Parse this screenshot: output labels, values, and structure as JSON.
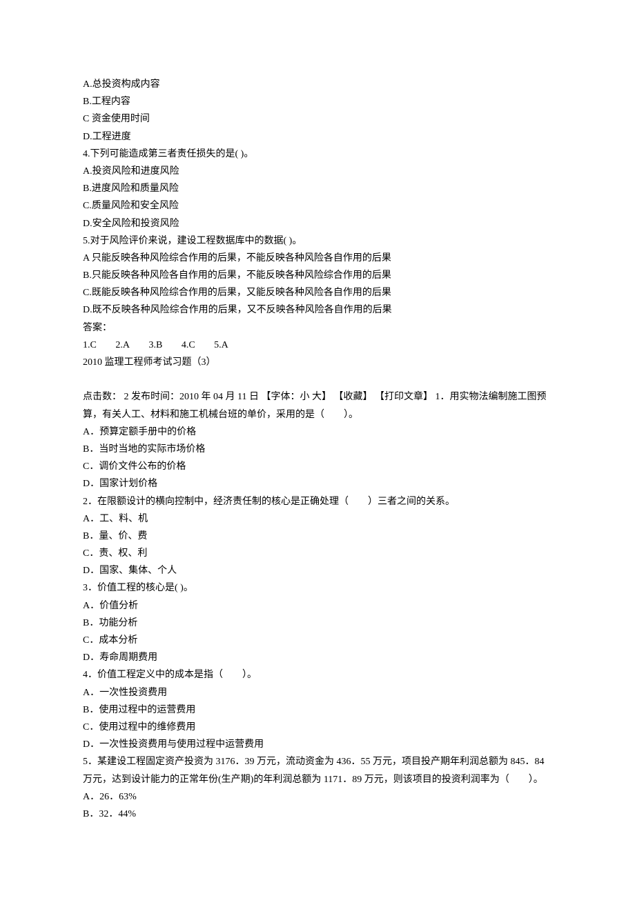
{
  "section1": {
    "q3_options": {
      "A": "A.总投资构成内容",
      "B": "B.工程内容",
      "C": "C 资金使用时间",
      "D": "D.工程进度"
    },
    "q4": {
      "stem": "4.下列可能造成第三者责任损失的是( )。",
      "A": "A.投资风险和进度风险",
      "B": "B.进度风险和质量风险",
      "C": "C.质量风险和安全风险",
      "D": "D.安全风险和投资风险"
    },
    "q5": {
      "stem": "5.对于风险评价来说，建设工程数据库中的数据( )。",
      "A": "A 只能反映各种风险综合作用的后果，不能反映各种风险各自作用的后果",
      "B": "B.只能反映各种风险各自作用的后果，不能反映各种风险综合作用的后果",
      "C": "C.既能反映各种风险综合作用的后果，又能反映各种风险各自作用的后果",
      "D": "D.既不反映各种风险综合作用的后果，又不反映各种风险各自作用的后果"
    },
    "answers": {
      "label": "答案：",
      "a1": "1.C",
      "a2": "2.A",
      "a3": "3.B",
      "a4": "4.C",
      "a5": "5.A"
    }
  },
  "section2": {
    "title": "2010 监理工程师考试习题（3）",
    "meta": "点击数： 2 发布时间：2010 年 04 月 11 日 【字体：小 大】 【收藏】 【打印文章】 1．用实物法编制施工图预算，有关人工、材料和施工机械台班的单价，采用的是（　　）。",
    "q1": {
      "A": "A．预算定额手册中的价格",
      "B": "B．当时当地的实际市场价格",
      "C": "C．调价文件公布的价格",
      "D": "D．国家计划价格"
    },
    "q2": {
      "stem": "2．在限额设计的横向控制中，经济责任制的核心是正确处理（　　）三者之间的关系。",
      "A": "A．工、料、机",
      "B": "B．量、价、费",
      "C": "C．责、权、利",
      "D": "D．国家、集体、个人"
    },
    "q3": {
      "stem": "3．价值工程的核心是( )。",
      "A": "A．价值分析",
      "B": "B．功能分析",
      "C": "C．成本分析",
      "D": "D．寿命周期费用"
    },
    "q4": {
      "stem": "4．价值工程定义中的成本是指（　　）。",
      "A": "A．一次性投资费用",
      "B": "B．使用过程中的运营费用",
      "C": "C．使用过程中的维修费用",
      "D": "D．一次性投资费用与使用过程中运营费用"
    },
    "q5": {
      "stem": "5．某建设工程固定资产投资为 3176．39 万元，流动资金为 436．55 万元，项目投产期年利润总额为 845．84 万元，达到设计能力的正常年份(生产期)的年利润总额为 1171．89 万元，则该项目的投资利润率为（　　）。",
      "A": "A．26．63%",
      "B": "B．32．44%"
    }
  }
}
